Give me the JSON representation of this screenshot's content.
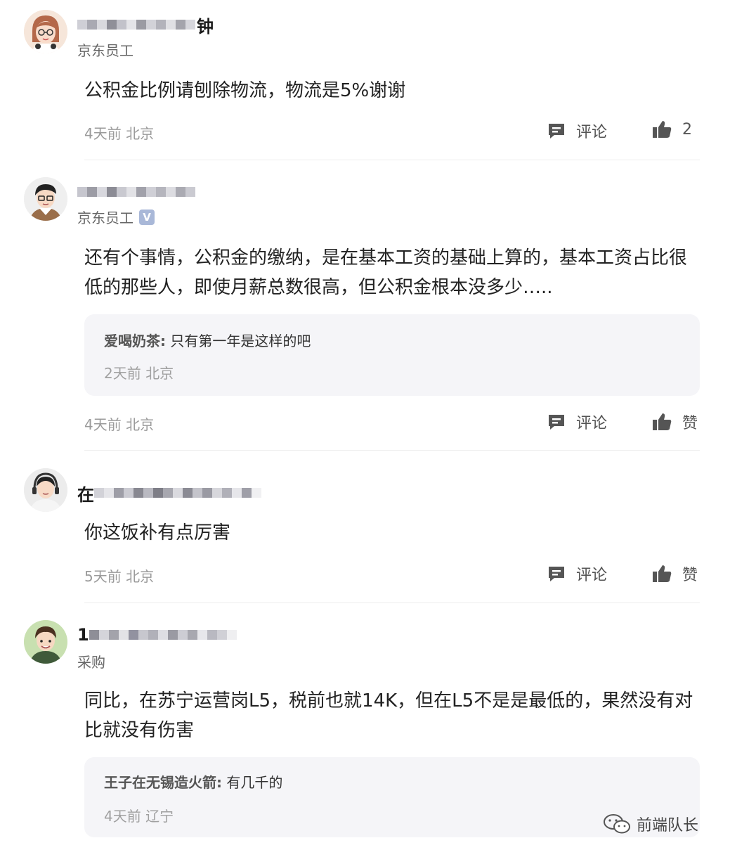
{
  "comments": [
    {
      "username_tail": "钟",
      "role": "京东员工",
      "verified": false,
      "text": "公积金比例请刨除物流，物流是5%谢谢",
      "meta": "4天前 北京",
      "comment_label": "评论",
      "like_label": "2"
    },
    {
      "username_tail": "",
      "role": "京东员工",
      "verified": true,
      "verified_mark": "V",
      "text": "还有个事情，公积金的缴纳，是在基本工资的基础上算的，基本工资占比很低的那些人，即使月薪总数很高，但公积金根本没多少…..",
      "reply": {
        "user": "爱喝奶茶",
        "sep": ":",
        "text": "只有第一年是这样的吧",
        "meta": "2天前 北京"
      },
      "meta": "4天前 北京",
      "comment_label": "评论",
      "like_label": "赞"
    },
    {
      "username_head": "在",
      "role": "",
      "verified": false,
      "text": "你这饭补有点厉害",
      "meta": "5天前 北京",
      "comment_label": "评论",
      "like_label": "赞"
    },
    {
      "username_head": "1",
      "role": "采购",
      "verified": false,
      "text": "同比，在苏宁运营岗L5，税前也就14K，但在L5不是是最低的，果然没有对比就没有伤害",
      "reply": {
        "user": "王子在无锡造火箭",
        "sep": ":",
        "text": "有几千的",
        "meta": "4天前 辽宁"
      }
    }
  ],
  "watermark": {
    "text": "前端队长",
    "icon": "wechat-icon"
  },
  "colors": {
    "meta": "#9a9a9a",
    "reply_bg": "#f5f5f8",
    "verified": "#a9b8d8"
  }
}
